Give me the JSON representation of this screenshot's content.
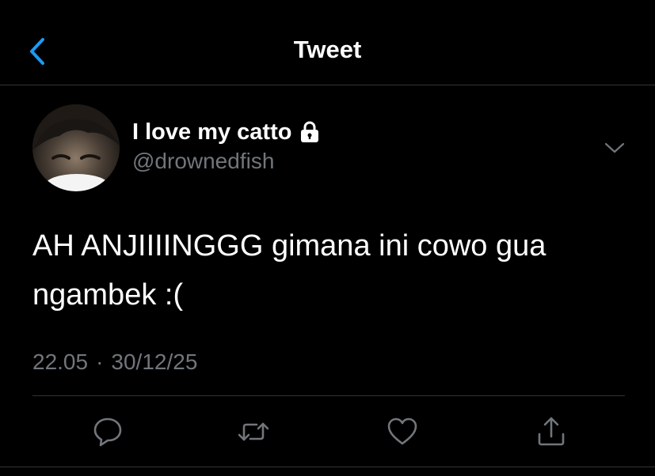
{
  "header": {
    "title": "Tweet",
    "back_icon": "chevron-left-icon"
  },
  "author": {
    "display_name": "I love my catto",
    "handle": "@drownedfish",
    "protected_icon": "lock-icon"
  },
  "tweet": {
    "text_lines": [
      "AH ANJIIIINGGG gimana ini cowo gua",
      "ngambek :("
    ],
    "time": "22.05",
    "separator": "·",
    "date": "30/12/25"
  },
  "actions": {
    "reply": "reply-icon",
    "retweet": "retweet-icon",
    "like": "heart-icon",
    "share": "share-icon"
  },
  "colors": {
    "background": "#000000",
    "accent": "#1d9bf0",
    "secondary_text": "#71767b",
    "divider": "#2f3336",
    "text": "#ffffff"
  }
}
